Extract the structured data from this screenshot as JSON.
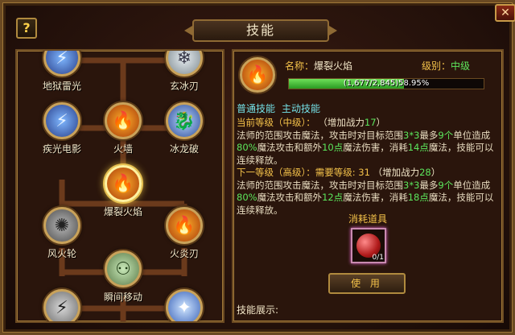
{
  "window": {
    "title": "技能",
    "help_label": "?",
    "close_label": "✕"
  },
  "tree": {
    "nodes": [
      {
        "label": "地狱雷光",
        "icon": "lightning-icon"
      },
      {
        "label": "玄冰刃",
        "icon": "ice-blade-icon"
      },
      {
        "label": "疾光电影",
        "icon": "lightning-icon"
      },
      {
        "label": "火墙",
        "icon": "fire-wall-icon"
      },
      {
        "label": "冰龙破",
        "icon": "ice-dragon-icon"
      },
      {
        "label": "爆裂火焰",
        "icon": "fire-icon"
      },
      {
        "label": "风火轮",
        "icon": "wheel-icon"
      },
      {
        "label": "火炎刃",
        "icon": "fire-blade-icon"
      },
      {
        "label": "瞬间移动",
        "icon": "teleport-icon"
      },
      {
        "label": "",
        "icon": "grey-skill-icon"
      },
      {
        "label": "",
        "icon": "crystal-skill-icon"
      }
    ]
  },
  "detail": {
    "name_key": "名称：",
    "name_value": "爆裂火焰",
    "level_key": "级别：",
    "level_value": "中级",
    "xp_text": "(1,677/2,845)58.95%",
    "xp_fraction": 0.5895,
    "tab_normal": "普通技能",
    "tab_active": "主动技能",
    "current": {
      "header": "当前等级（中级）：",
      "power_prefix": "（增加战力",
      "power_value": "17",
      "power_suffix": "）",
      "text_a": "法师的范围攻击魔法，攻击时对目标范围",
      "range": "3*3",
      "text_b": "最多",
      "count": "9个",
      "text_c": "单位造成",
      "pct": "80%",
      "text_d": "魔法攻击和额外",
      "extra": "10点",
      "text_e": "魔法伤害，消耗",
      "cost": "14点",
      "text_f": "魔法，技能可以连续释放。"
    },
    "next": {
      "header": "下一等级（高级）：需要等级: 31",
      "power_prefix": "（增加战力",
      "power_value": "28",
      "power_suffix": "）",
      "text_a": "法师的范围攻击魔法，攻击时对目标范围",
      "range": "3*3",
      "text_b": "最多",
      "count": "9个",
      "text_c": "单位造成",
      "pct": "80%",
      "text_d": "魔法攻击和额外",
      "extra": "12点",
      "text_e": "魔法伤害，消耗",
      "cost": "18点",
      "text_f": "魔法，技能可以连续释放。"
    },
    "consume_title": "消耗道具",
    "item_count": "0/1",
    "use_label": "使 用",
    "show_label": "技能展示:"
  }
}
